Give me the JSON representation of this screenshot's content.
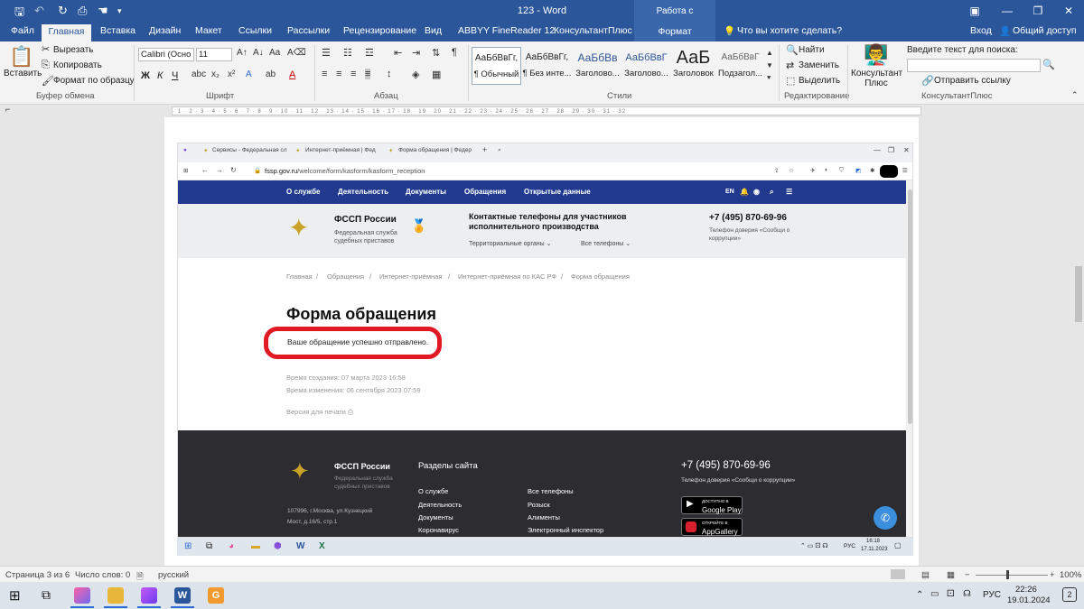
{
  "word": {
    "title": "123 - Word",
    "picture_tools": "Работа с рисунками",
    "window_buttons": {
      "restore_ribbon": "▣",
      "minimize": "—",
      "maximize": "❐",
      "close": "✕"
    },
    "tabs": [
      "Файл",
      "Главная",
      "Вставка",
      "Дизайн",
      "Макет",
      "Ссылки",
      "Рассылки",
      "Рецензирование",
      "Вид",
      "ABBYY FineReader 12",
      "КонсультантПлюс",
      "Формат"
    ],
    "tell_me": "Что вы хотите сделать?",
    "sign_in": "Вход",
    "share": "Общий доступ",
    "clipboard": {
      "paste": "Вставить",
      "cut": "Вырезать",
      "copy": "Копировать",
      "format_painter": "Формат по образцу",
      "label": "Буфер обмена"
    },
    "font": {
      "name": "Calibri (Осно",
      "size": "11",
      "label": "Шрифт",
      "bold": "Ж",
      "italic": "К",
      "underline": "Ч"
    },
    "paragraph": {
      "label": "Абзац"
    },
    "styles": {
      "label": "Стили",
      "items": [
        {
          "sample": "АаБбВвГг,",
          "name": "¶ Обычный"
        },
        {
          "sample": "АаБбВвГг,",
          "name": "¶ Без инте..."
        },
        {
          "sample": "АаБбВв",
          "name": "Заголово..."
        },
        {
          "sample": "АаБбВвГ",
          "name": "Заголово..."
        },
        {
          "sample": "АаБ",
          "name": "Заголовок"
        },
        {
          "sample": "АаБбВвГ",
          "name": "Подзагол..."
        }
      ]
    },
    "editing": {
      "find": "Найти",
      "replace": "Заменить",
      "select": "Выделить",
      "label": "Редактирование"
    },
    "consultant": {
      "button": "Консультант Плюс",
      "search_label": "Введите текст для поиска:",
      "send_link": "Отправить ссылку",
      "label": "КонсультантПлюс"
    },
    "status": {
      "page": "Страница 3 из 6",
      "words": "Число слов: 0",
      "language": "русский",
      "zoom": "100%"
    }
  },
  "browser": {
    "tabs": [
      "Сервисы - Федеральная сл",
      "Интернет-приёмная | Фед",
      "Форма обращения | Федер"
    ],
    "url_host": "fssp.gov.ru",
    "url_path": "/welcome/form/kasform/kasform_reception"
  },
  "site": {
    "nav": [
      "О службе",
      "Деятельность",
      "Документы",
      "Обращения",
      "Открытые данные"
    ],
    "lang": "EN",
    "org_name": "ФССП России",
    "org_sub": "Федеральная служба судебных приставов",
    "contacts_title": "Контактные телефоны для участников исполнительного производства",
    "territorial": "Территориальные органы",
    "all_phones": "Все телефоны",
    "phone": "+7 (495) 870-69-96",
    "trust_line": "Телефон доверия «Сообщи о коррупции»",
    "breadcrumbs": [
      "Главная",
      "Обращения",
      "Интернет-приёмная",
      "Интернет-приёмная по КАС РФ",
      "Форма обращения"
    ],
    "form_title": "Форма обращения",
    "success": "Ваше обращение успешно отправлено.",
    "created": "Время создания: 07 марта 2023 16:58",
    "modified": "Время изменения: 06 сентября 2023 07:59",
    "print": "Версия для печати",
    "footer": {
      "org_name": "ФССП России",
      "org_sub": "Федеральная служба судебных приставов",
      "address1": "107996, г.Москва, ул.Кузнецкий",
      "address2": "Мост, д.16/5, стр.1",
      "sections_title": "Разделы сайта",
      "col1": [
        "О службе",
        "Деятельность",
        "Документы",
        "Коронавирус"
      ],
      "col2": [
        "Все телефоны",
        "Розыск",
        "Алименты",
        "Электронный инспектор"
      ],
      "phone": "+7 (495) 870-69-96",
      "trust_line": "Телефон доверия «Сообщи о коррупции»",
      "google_small": "ДОСТУПНО В",
      "google": "Google Play",
      "app_small": "ОТКРОЙТЕ В",
      "app": "AppGallery"
    }
  },
  "inner_taskbar": {
    "lang": "РУС",
    "time": "16:18",
    "date": "17.11.2023"
  },
  "taskbar": {
    "lang": "РУС",
    "time": "22:26",
    "date": "19.01.2024",
    "notifications": "2"
  },
  "colors": {
    "word_blue": "#2b579a",
    "site_nav": "#213a8e",
    "highlight": "#e01923"
  }
}
